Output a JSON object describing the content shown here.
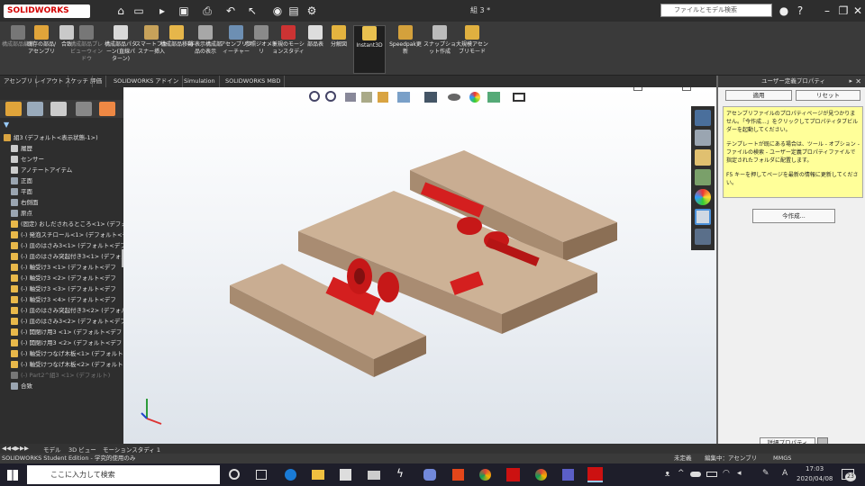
{
  "app": {
    "logo": "SOLIDWORKS",
    "doc_title": "組 3 *"
  },
  "search": {
    "placeholder": "ファイルとモデル検索"
  },
  "ribbon": [
    {
      "label": "構成部品編集",
      "dim": true
    },
    {
      "label": "既存の部品/アセンブリ"
    },
    {
      "label": "合致"
    },
    {
      "label": "構成部品プレビューウィンドウ",
      "dim": true
    },
    {
      "label": "構成部品パターン(直線パターン)"
    },
    {
      "label": "スマートファスナー挿入"
    },
    {
      "label": "構成部品移動"
    },
    {
      "label": "非表示構成部品の表示"
    },
    {
      "label": "アセンブリフィーチャー"
    },
    {
      "label": "参照ジオメトリ"
    },
    {
      "label": "新規のモーションスタディ"
    },
    {
      "label": "部品表"
    },
    {
      "label": "分解図"
    },
    {
      "label": "Instant3D",
      "active": true
    },
    {
      "label": "Speedpak更新"
    },
    {
      "label": "スナップショット作成"
    },
    {
      "label": "大規模アセンブリモード"
    }
  ],
  "tabs": [
    "アセンブリ",
    "レイアウト",
    "スケッチ",
    "評価",
    "SOLIDWORKS アドイン",
    "Simulation",
    "SOLIDWORKS MBD"
  ],
  "tree": [
    {
      "label": "組3 (デフォルト<表示状態-1>)",
      "color": "#d9a441"
    },
    {
      "label": "履歴",
      "color": "#cccccc"
    },
    {
      "label": "センサー",
      "color": "#cccccc"
    },
    {
      "label": "アノテートアイテム",
      "color": "#cccccc"
    },
    {
      "label": "正面",
      "color": "#9aa5b1"
    },
    {
      "label": "平面",
      "color": "#9aa5b1"
    },
    {
      "label": "右側面",
      "color": "#9aa5b1"
    },
    {
      "label": "原点",
      "color": "#9aa5b1"
    },
    {
      "label": "(固定) おしだされるところ<1> (デフォルト",
      "color": "#e8b84a"
    },
    {
      "label": "(-) 発泡スチロール<1> (デフォルト<デ",
      "color": "#e8b84a"
    },
    {
      "label": "(-) 皿のはさみ3<1> (デフォルト<デフォ",
      "color": "#e8b84a"
    },
    {
      "label": "(-) 皿のはさみ突起付き3<1> (デフォルト",
      "color": "#e8b84a"
    },
    {
      "label": "(-) 軸受け3 <1> (デフォルト<デフ",
      "color": "#e8b84a"
    },
    {
      "label": "(-) 軸受け3 <2> (デフォルト<デフ",
      "color": "#e8b84a"
    },
    {
      "label": "(-) 軸受け3 <3> (デフォルト<デフ",
      "color": "#e8b84a"
    },
    {
      "label": "(-) 軸受け3 <4> (デフォルト<デフ",
      "color": "#e8b84a"
    },
    {
      "label": "(-) 皿のはさみ突起付き3<2> (デフォル",
      "color": "#e8b84a"
    },
    {
      "label": "(-) 皿のはさみ3<2> (デフォルト<デフォ",
      "color": "#e8b84a"
    },
    {
      "label": "(-) 開閉け用3 <1> (デフォルト<デフ",
      "color": "#e8b84a"
    },
    {
      "label": "(-) 開閉け用3 <2> (デフォルト<デフ",
      "color": "#e8b84a"
    },
    {
      "label": "(-) 軸受けつなげ木板<1> (デフォルト",
      "color": "#e8b84a"
    },
    {
      "label": "(-) 軸受けつなげ木板<2> (デフォルト",
      "color": "#e8b84a"
    },
    {
      "label": "(-) Part2^組3 <1> (デフォルト)",
      "color": "#777777",
      "dim": true
    },
    {
      "label": "合致",
      "color": "#9aa5b1"
    }
  ],
  "bottom_tabs": [
    "モデル",
    "3D ビュー",
    "モーションスタディ 1"
  ],
  "status": {
    "left": "SOLIDWORKS Student Edition - 学究的使用のみ",
    "undefined": "未定義",
    "editing": "編集中：アセンブリ",
    "units": "MMGS"
  },
  "props": {
    "title": "ユーザー定義プロパティ",
    "apply": "適用",
    "reset": "リセット",
    "note1": "アセンブリファイルのプロパティページが見つかりません。「今作成...」をクリックしてプロパティタブビルダーを起動してください。",
    "note2": "テンプレートが既にある場合は、ツール - オプション - ファイルの検索 - ユーザー定義プロパティファイルで指定されたフォルダに配置します。",
    "note3": "F5 キーを押してページを最新の情報に更新してください。",
    "create": "今作成...",
    "detail": "詳細プロパティ"
  },
  "taskbar": {
    "search_placeholder": "ここに入力して検索",
    "ime": "A",
    "time": "17:03",
    "date": "2020/04/08",
    "notify_count": "23"
  }
}
